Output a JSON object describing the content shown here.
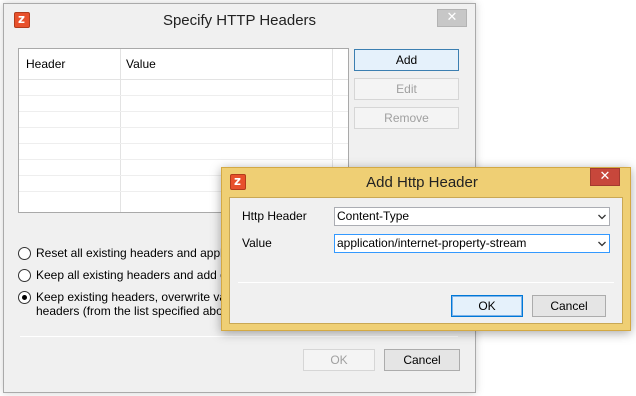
{
  "main_dialog": {
    "title": "Specify HTTP Headers",
    "close_glyph": "✕",
    "grid_columns": [
      "Header",
      "Value"
    ],
    "buttons": {
      "add": "Add",
      "edit": "Edit",
      "remove": "Remove",
      "ok": "OK",
      "cancel": "Cancel"
    },
    "options": [
      {
        "label": "Reset all existing headers and apply sp",
        "checked": false
      },
      {
        "label": "Keep all existing headers and add only",
        "checked": false
      },
      {
        "label_line1": "Keep existing headers, overwrite values",
        "label_line2": "headers (from the list specified above)",
        "checked": true
      }
    ]
  },
  "add_dialog": {
    "title": "Add Http Header",
    "close_glyph": "✕",
    "fields": [
      {
        "label": "Http Header",
        "value": "Content-Type"
      },
      {
        "label": "Value",
        "value": "application/internet-property-stream"
      }
    ],
    "buttons": {
      "ok": "OK",
      "cancel": "Cancel"
    }
  },
  "icons": {
    "app": "zap-app-icon",
    "dropdown": "chevron-down-icon",
    "close": "close-icon"
  },
  "colors": {
    "child_frame": "#efcf74",
    "close_active": "#c7473b",
    "focus": "#0078d7"
  }
}
